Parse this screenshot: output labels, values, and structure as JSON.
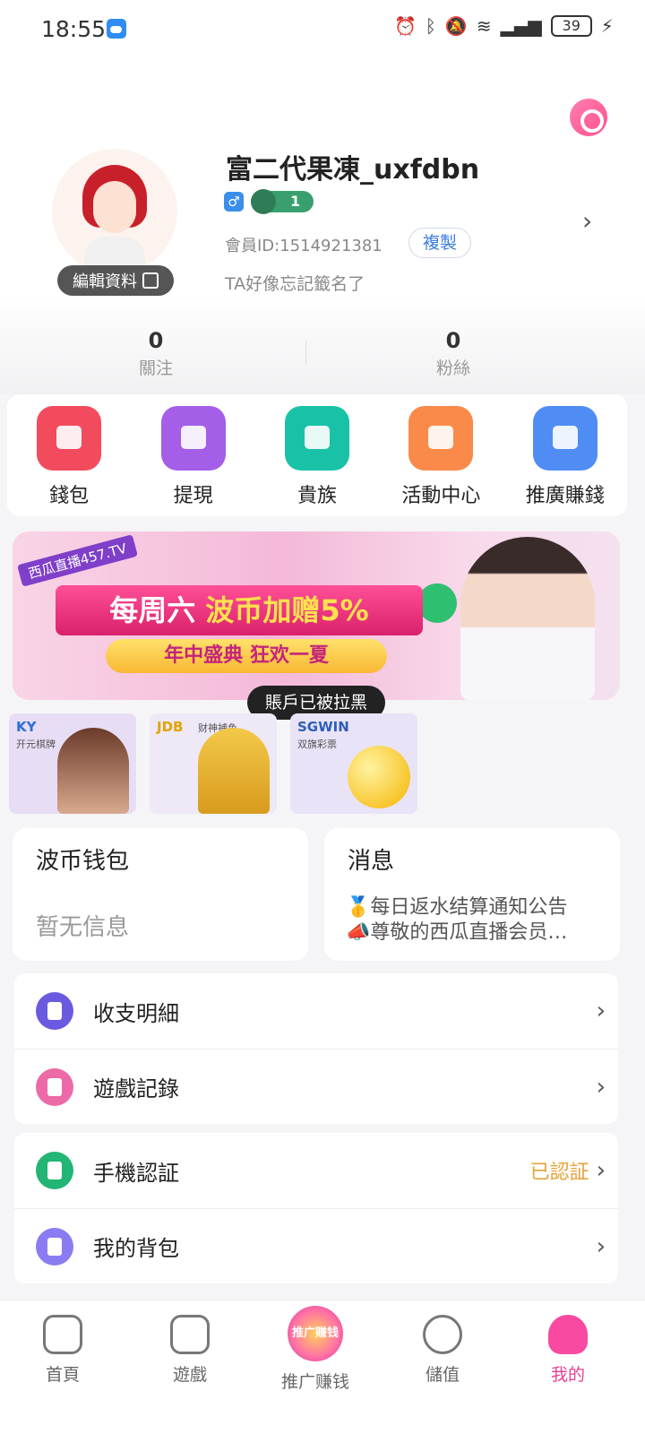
{
  "status_bar": {
    "time": "18:55",
    "battery": "39"
  },
  "profile": {
    "username": "富二代果凍_uxfdbn",
    "gender_symbol": "♂",
    "level": "1",
    "member_id": "會員ID:1514921381",
    "copy_label": "複製",
    "signature": "TA好像忘記籤名了",
    "edit_label": "編輯資料"
  },
  "stats": [
    {
      "count": "0",
      "label": "關注"
    },
    {
      "count": "0",
      "label": "粉絲"
    }
  ],
  "actions": [
    {
      "label": "錢包",
      "color": "#f24b5e"
    },
    {
      "label": "提現",
      "color": "#a45ee8"
    },
    {
      "label": "貴族",
      "color": "#19c2a7"
    },
    {
      "label": "活動中心",
      "color": "#f98a4a"
    },
    {
      "label": "推廣賺錢",
      "color": "#4f8df5"
    }
  ],
  "banner": {
    "tag": "西瓜直播457.TV",
    "line1_a": "每周六 ",
    "line1_b": "波币加赠5%",
    "line2": "年中盛典 狂欢一夏"
  },
  "toast": "賬戶已被拉黑",
  "games": [
    {
      "label": "KY",
      "sublabel": "开元棋牌",
      "color": "#e7def5"
    },
    {
      "label": "JDB",
      "sublabel": "财神捕鱼",
      "color": "#efe8f6"
    },
    {
      "label": "SGWIN",
      "sublabel": "双旗彩票",
      "color": "#e9e3f7"
    }
  ],
  "wallet_card": {
    "title": "波币钱包",
    "empty_text": "暂无信息"
  },
  "message_card": {
    "title": "消息",
    "lines": [
      "🥇每日返水结算通知公告",
      "📣尊敬的西瓜直播会员…"
    ]
  },
  "menu_group_1": [
    {
      "label": "收支明細",
      "color": "#6a5ae0"
    },
    {
      "label": "遊戲記錄",
      "color": "#ec6aa8"
    }
  ],
  "menu_group_2": [
    {
      "label": "手機認証",
      "status": "已認証",
      "color": "#22b573"
    },
    {
      "label": "我的背包",
      "color": "#8a7cf0"
    }
  ],
  "chevron": "›",
  "bottom_nav": [
    {
      "label": "首頁"
    },
    {
      "label": "遊戲"
    },
    {
      "label": "推广赚钱",
      "badge": "推广赚钱"
    },
    {
      "label": "儲值"
    },
    {
      "label": "我的"
    }
  ]
}
